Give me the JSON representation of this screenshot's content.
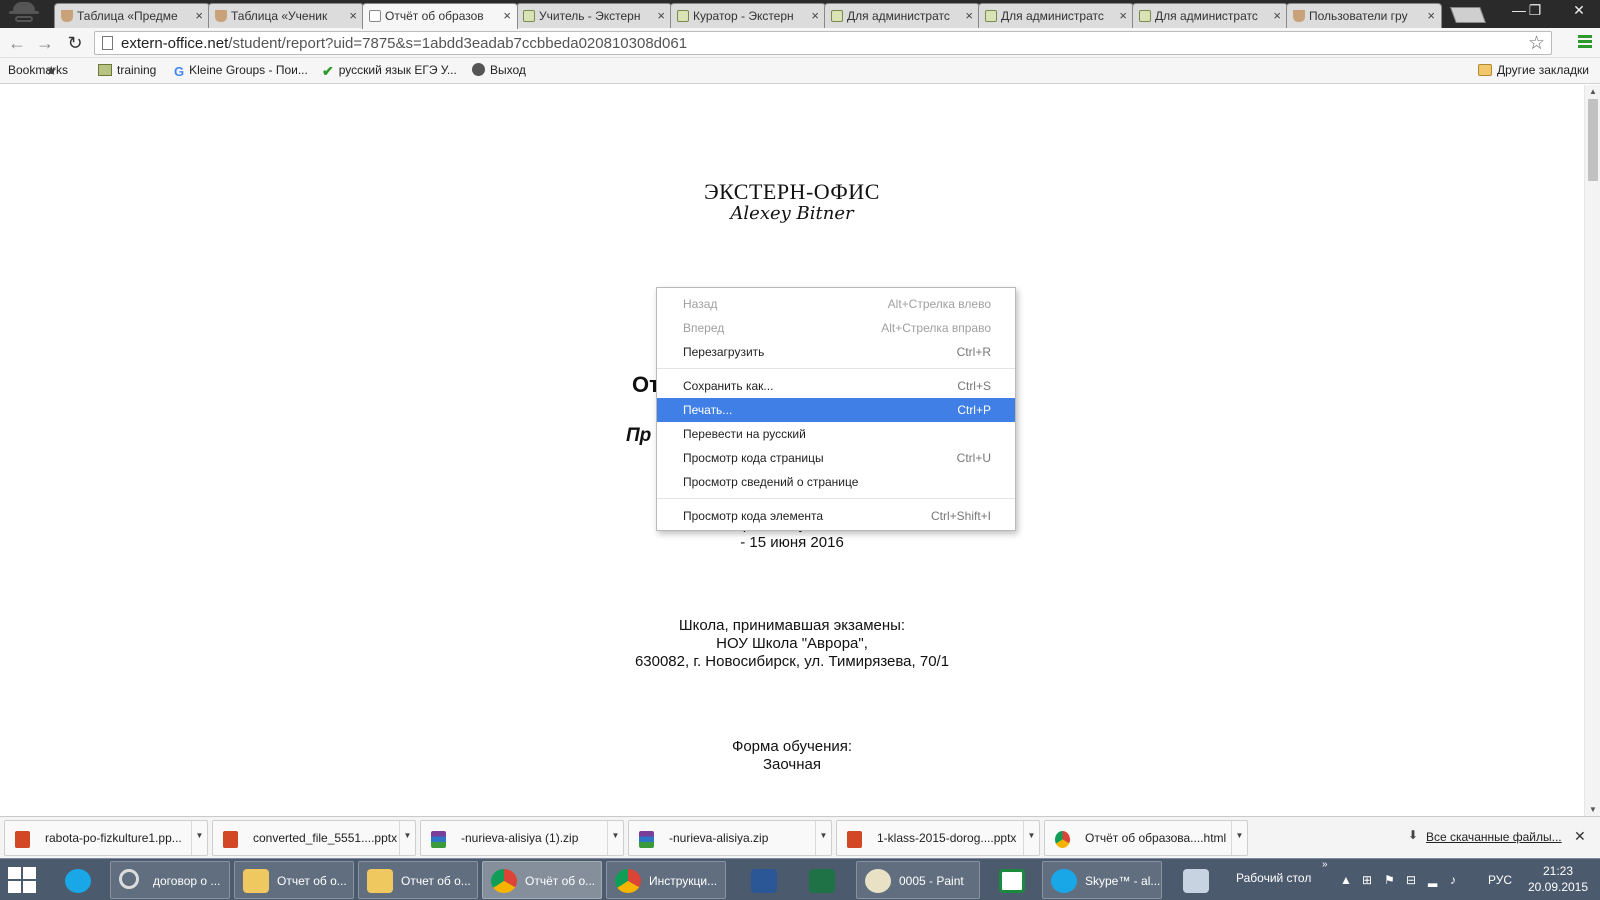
{
  "browser": {
    "tabs": [
      {
        "title": "Таблица «Предме",
        "icon": "cup-icon"
      },
      {
        "title": "Таблица «Ученик",
        "icon": "cup-icon"
      },
      {
        "title": "Отчёт об образов",
        "icon": "page-icon",
        "active": true
      },
      {
        "title": "Учитель - Экстерн",
        "icon": "grid-icon"
      },
      {
        "title": "Куратор - Экстерн",
        "icon": "grid-icon"
      },
      {
        "title": "Для администратс",
        "icon": "grid-icon"
      },
      {
        "title": "Для администратс",
        "icon": "grid-icon"
      },
      {
        "title": "Для администратс",
        "icon": "grid-icon"
      },
      {
        "title": "Пользователи гру",
        "icon": "cup-icon"
      }
    ],
    "address": {
      "host": "extern-office.net",
      "path": "/student/report?uid=7875&s=1abdd3eadab7ccbbeda020810308d061"
    },
    "bookmarks": [
      {
        "label": "Bookmarks",
        "icon": "star-icon"
      },
      {
        "label": "training",
        "icon": "training-icon"
      },
      {
        "label": "Kleine Groups - Пои...",
        "icon": "google-icon"
      },
      {
        "label": "русский язык ЕГЭ У...",
        "icon": "check-icon"
      },
      {
        "label": "Выход",
        "icon": "exit-icon"
      }
    ],
    "other_bookmarks": "Другие закладки"
  },
  "page": {
    "logo_title": "ЭКСТЕРН-ОФИС",
    "logo_signature": "Alexey Bitner",
    "report_title_fragment": "От",
    "report_subtitle_fragment": "Пр",
    "study_time_label": "Время обучения:",
    "study_time_value": "- 15 июня 2016",
    "school_label": "Школа, принимавшая экзамены:",
    "school_name": "НОУ Школа \"Аврора\",",
    "school_address": "630082, г. Новосибирск, ул. Тимирязева, 70/1",
    "form_label": "Форма обучения:",
    "form_value": "Заочная"
  },
  "context_menu": {
    "items": [
      {
        "label": "Назад",
        "shortcut": "Alt+Стрелка влево",
        "disabled": true
      },
      {
        "label": "Вперед",
        "shortcut": "Alt+Стрелка вправо",
        "disabled": true
      },
      {
        "label": "Перезагрузить",
        "shortcut": "Ctrl+R"
      },
      {
        "label": "Сохранить как...",
        "shortcut": "Ctrl+S"
      },
      {
        "label": "Печать...",
        "shortcut": "Ctrl+P",
        "highlighted": true
      },
      {
        "label": "Перевести на русский",
        "shortcut": ""
      },
      {
        "label": "Просмотр кода страницы",
        "shortcut": "Ctrl+U"
      },
      {
        "label": "Просмотр  сведений о странице",
        "shortcut": ""
      },
      {
        "label": "Просмотр кода элемента",
        "shortcut": "Ctrl+Shift+I"
      }
    ]
  },
  "downloads": {
    "items": [
      {
        "name": "rabota-po-fizkulture1.pp...",
        "icon": "ppt-icon"
      },
      {
        "name": "converted_file_5551....pptx",
        "icon": "ppt-icon"
      },
      {
        "name": "-nurieva-alisiya (1).zip",
        "icon": "zip-icon"
      },
      {
        "name": "-nurieva-alisiya.zip",
        "icon": "zip-icon"
      },
      {
        "name": "1-klass-2015-dorog....pptx",
        "icon": "ppt-icon"
      },
      {
        "name": "Отчёт об образова....html",
        "icon": "chrome-icon"
      }
    ],
    "all_downloads": "Все скачанные файлы..."
  },
  "taskbar": {
    "items": [
      {
        "label": "",
        "icon": "skype-icon"
      },
      {
        "label": "договор о ...",
        "icon": "search-icon"
      },
      {
        "label": "Отчет об о...",
        "icon": "folder-icon"
      },
      {
        "label": "Отчет об о...",
        "icon": "folder-icon"
      },
      {
        "label": "Отчёт об о...",
        "icon": "chrome-icon",
        "active": true
      },
      {
        "label": "Инструкци...",
        "icon": "chrome-icon"
      },
      {
        "label": "",
        "icon": "word-icon"
      },
      {
        "label": "",
        "icon": "excel-icon"
      },
      {
        "label": "0005 - Paint",
        "icon": "paint-icon"
      },
      {
        "label": "",
        "icon": "camtasia-icon"
      },
      {
        "label": "Skype™ - al...",
        "icon": "skype-icon"
      },
      {
        "label": "",
        "icon": "calculator-icon"
      }
    ],
    "desktop_label": "Рабочий стол",
    "language": "РУС",
    "time": "21:23",
    "date": "20.09.2015"
  }
}
